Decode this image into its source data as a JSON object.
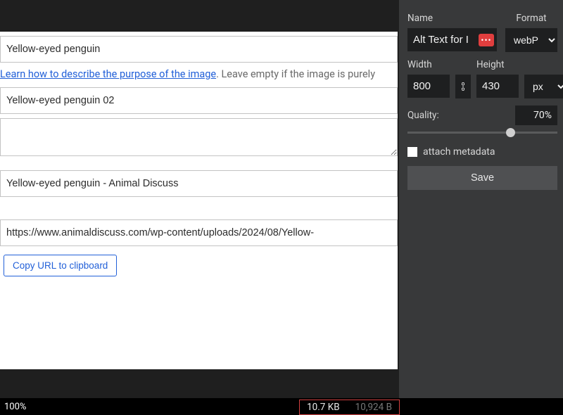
{
  "leftPanel": {
    "altText": "Yellow-eyed penguin",
    "helpLinkText": "Learn how to describe the purpose of the image",
    "helpTrailing": ". Leave empty if the image is purely",
    "title": "Yellow-eyed penguin 02",
    "caption": "",
    "description": "Yellow-eyed penguin - Animal Discuss",
    "url": "https://www.animaldiscuss.com/wp-content/uploads/2024/08/Yellow-",
    "copyBtn": "Copy URL to clipboard"
  },
  "rightPanel": {
    "labels": {
      "name": "Name",
      "format": "Format",
      "width": "Width",
      "height": "Height",
      "quality": "Quality:",
      "attachMetadata": "attach metadata",
      "save": "Save"
    },
    "name": "Alt Text for I",
    "format": "webP",
    "width": "800",
    "height": "430",
    "unit": "px",
    "quality": "70%",
    "qualitySlider": 70
  },
  "status": {
    "zoom": "100%",
    "sizeKB": "10.7 KB",
    "sizeBytes": "10,924 B"
  }
}
